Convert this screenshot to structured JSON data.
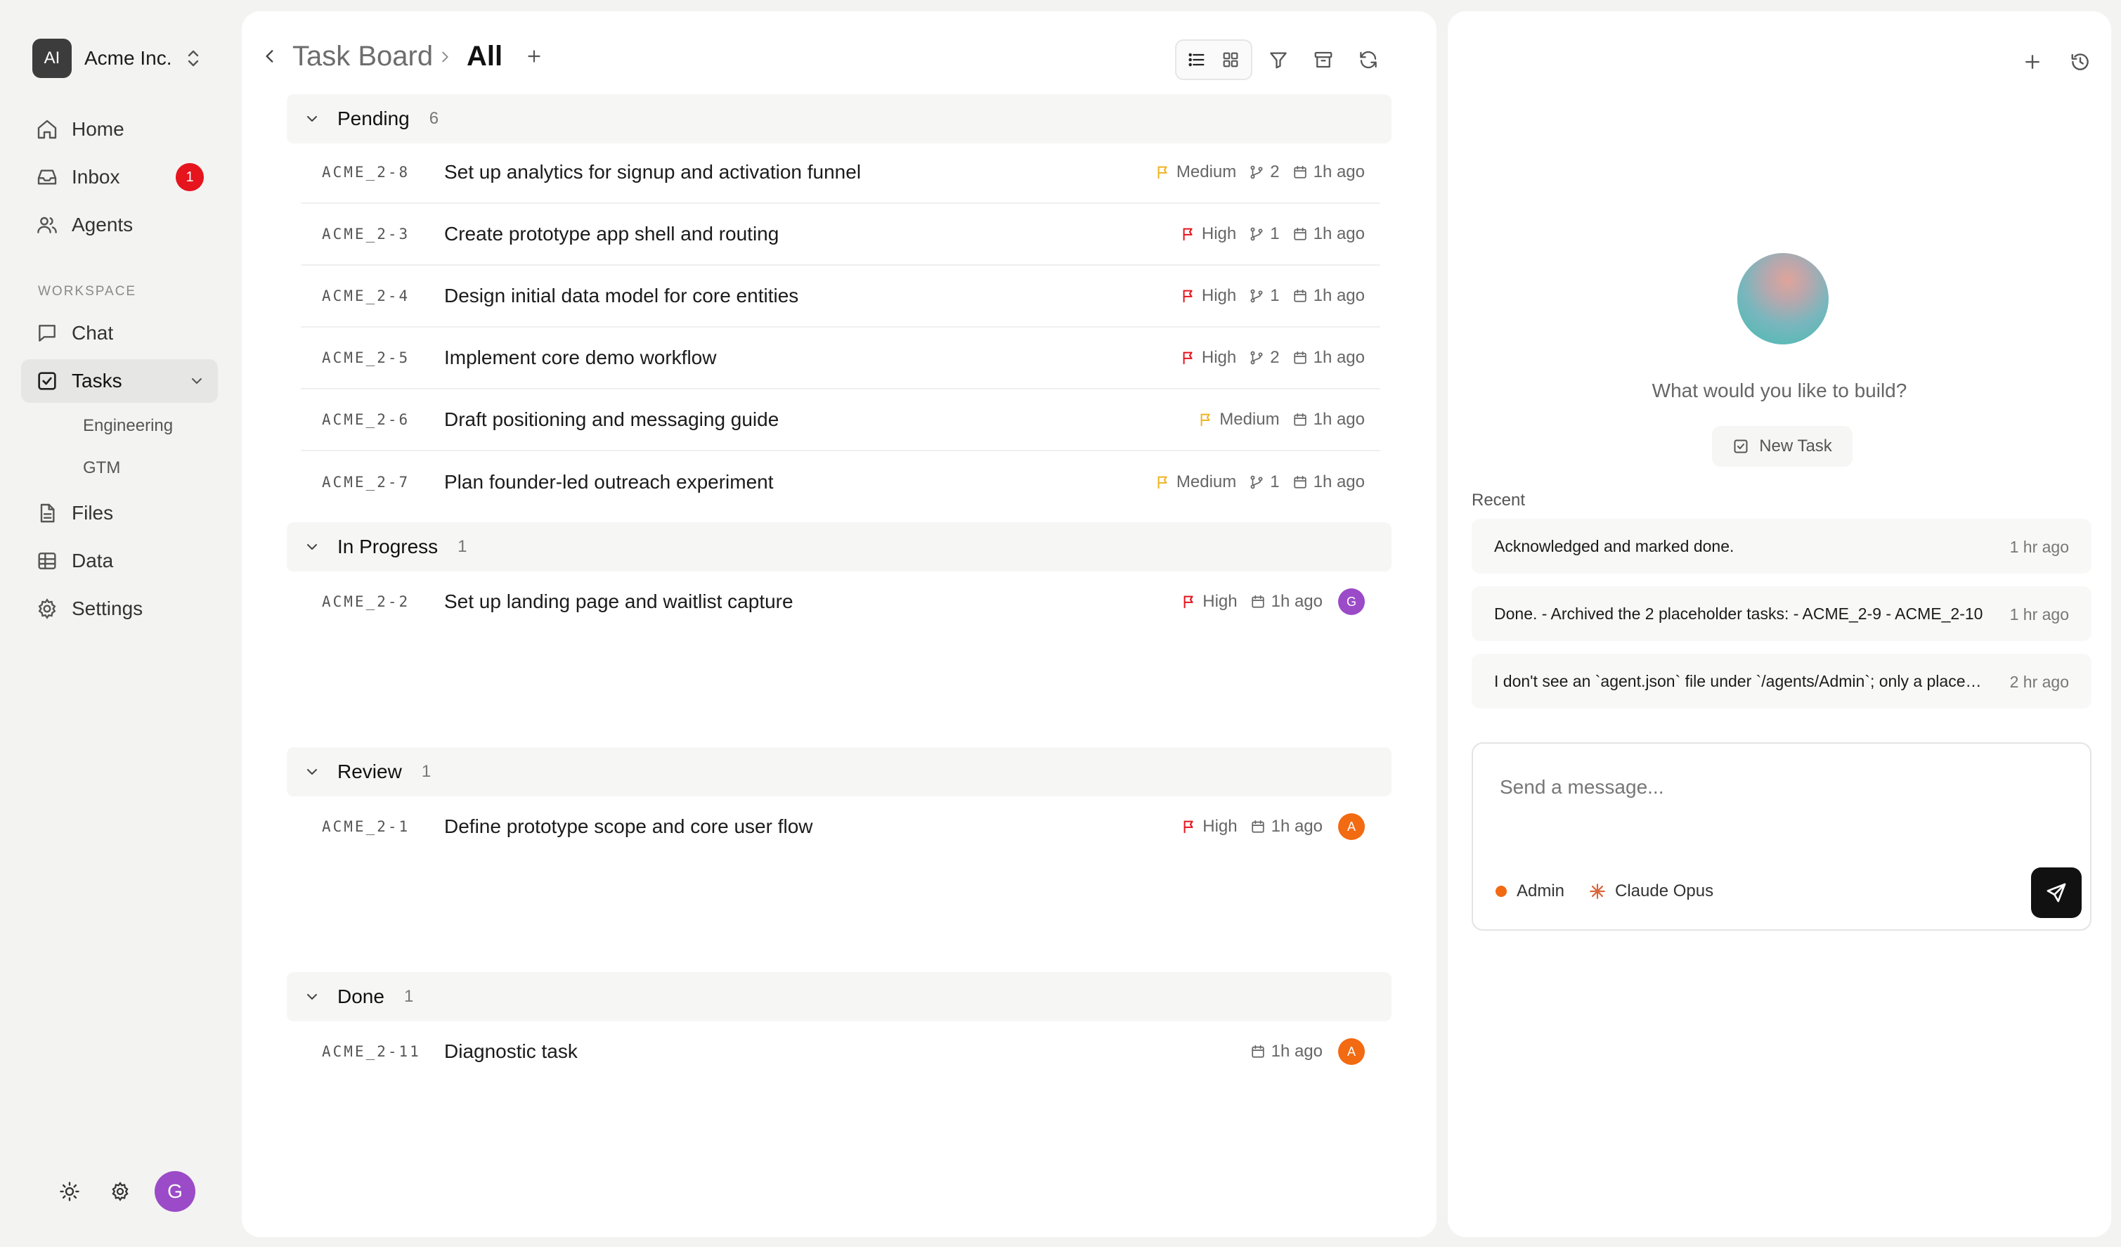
{
  "colors": {
    "priority_medium": "#f0b323",
    "priority_high": "#e5141d",
    "badge": "#e5141d",
    "avatar_g": "#9b4bc7",
    "avatar_a": "#f26a12",
    "accent_dot": "#f26a12"
  },
  "org": {
    "avatar": "AI",
    "name": "Acme Inc."
  },
  "nav": {
    "home": "Home",
    "inbox": "Inbox",
    "inbox_badge": "1",
    "agents": "Agents",
    "workspace_label": "WORKSPACE",
    "chat": "Chat",
    "tasks": "Tasks",
    "tasks_sub": [
      "Engineering",
      "GTM"
    ],
    "files": "Files",
    "data": "Data",
    "settings": "Settings"
  },
  "user": {
    "avatar": "G"
  },
  "header": {
    "crumb": "Task Board",
    "current": "All"
  },
  "groups": [
    {
      "title": "Pending",
      "count": "6",
      "tasks": [
        {
          "id": "ACME_2-8",
          "title": "Set up analytics for signup and activation funnel",
          "priority": "Medium",
          "branches": "2",
          "time": "1h ago"
        },
        {
          "id": "ACME_2-3",
          "title": "Create prototype app shell and routing",
          "priority": "High",
          "branches": "1",
          "time": "1h ago"
        },
        {
          "id": "ACME_2-4",
          "title": "Design initial data model for core entities",
          "priority": "High",
          "branches": "1",
          "time": "1h ago"
        },
        {
          "id": "ACME_2-5",
          "title": "Implement core demo workflow",
          "priority": "High",
          "branches": "2",
          "time": "1h ago"
        },
        {
          "id": "ACME_2-6",
          "title": "Draft positioning and messaging guide",
          "priority": "Medium",
          "branches": "",
          "time": "1h ago"
        },
        {
          "id": "ACME_2-7",
          "title": "Plan founder-led outreach experiment",
          "priority": "Medium",
          "branches": "1",
          "time": "1h ago"
        }
      ]
    },
    {
      "title": "In Progress",
      "count": "1",
      "tasks": [
        {
          "id": "ACME_2-2",
          "title": "Set up landing page and waitlist capture",
          "priority": "High",
          "time": "1h ago",
          "assignee": "G"
        }
      ]
    },
    {
      "title": "Review",
      "count": "1",
      "tasks": [
        {
          "id": "ACME_2-1",
          "title": "Define prototype scope and core user flow",
          "priority": "High",
          "time": "1h ago",
          "assignee": "A"
        }
      ]
    },
    {
      "title": "Done",
      "count": "1",
      "tasks": [
        {
          "id": "ACME_2-11",
          "title": "Diagnostic task",
          "time": "1h ago",
          "assignee": "A"
        }
      ]
    }
  ],
  "right": {
    "prompt": "What would you like to build?",
    "new_task": "New Task",
    "recent_label": "Recent",
    "recent": [
      {
        "text": "Acknowledged and marked done.",
        "time": "1 hr ago"
      },
      {
        "text": "Done. - Archived the 2 placeholder tasks: - ACME_2-9 - ACME_2-10",
        "time": "1 hr ago"
      },
      {
        "text": "I don't see an `agent.json` file under `/agents/Admin`; only a placeholder exists",
        "time": "2 hr ago"
      }
    ],
    "composer_placeholder": "Send a message...",
    "agent": "Admin",
    "model": "Claude Opus"
  }
}
